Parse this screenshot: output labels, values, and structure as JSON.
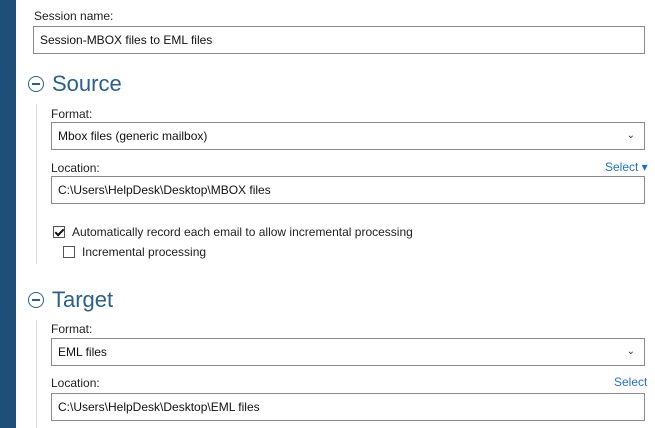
{
  "session": {
    "label": "Session name:",
    "value": "Session-MBOX files to EML files"
  },
  "source": {
    "title": "Source",
    "format_label": "Format:",
    "format_value": "Mbox files (generic mailbox)",
    "location_label": "Location:",
    "location_select": "Select ▾",
    "location_value": "C:\\Users\\HelpDesk\\Desktop\\MBOX files",
    "auto_record": {
      "label": "Automatically record each email to allow incremental processing",
      "checked": true
    },
    "incremental": {
      "label": "Incremental processing",
      "checked": false
    }
  },
  "target": {
    "title": "Target",
    "format_label": "Format:",
    "format_value": "EML files",
    "location_label": "Location:",
    "location_select": "Select",
    "location_value": "C:\\Users\\HelpDesk\\Desktop\\EML files"
  },
  "colors": {
    "sidebar": "#1f4e79",
    "heading": "#2a5f8f",
    "link": "#1f6fd1"
  }
}
